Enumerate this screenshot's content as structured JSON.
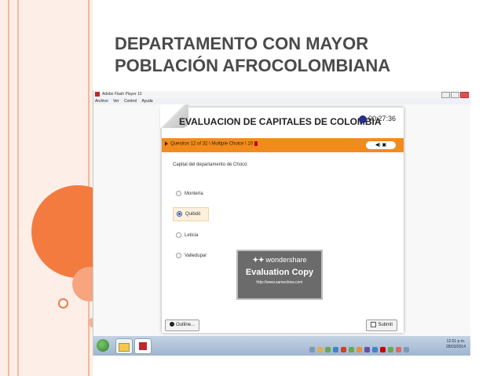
{
  "slide": {
    "title": "DEPARTAMENTO CON MAYOR\nPOBLACIÓN  AFROCOLOMBIANA"
  },
  "window": {
    "title": "Adobe Flash Player 10",
    "menu": [
      "Archivo",
      "Ver",
      "Control",
      "Ayuda"
    ]
  },
  "quiz": {
    "title": "EVALUACION DE CAPITALES DE COLOMBIA",
    "timer": "00:27:36",
    "question_info": "Question 12 of 32 \\ Multiple Choice \\ 10",
    "question": "Capital del departamento de Chocó:",
    "options": [
      {
        "label": "Montería",
        "selected": false
      },
      {
        "label": "Quibdó",
        "selected": true
      },
      {
        "label": "Leticia",
        "selected": false
      },
      {
        "label": "Valledupar",
        "selected": false
      }
    ],
    "outline_button": "Outline...",
    "submit_button": "Submit"
  },
  "watermark": {
    "brand": "wondershare",
    "text": "Evaluation Copy",
    "url": "http://www.sameshow.com"
  },
  "taskbar": {
    "time": "12:01 p.m.",
    "date": "28/03/2014"
  },
  "colors": {
    "accent_orange": "#f28b1e",
    "slide_title": "#4a4a4a",
    "decor_orange": "#f47b3f"
  }
}
